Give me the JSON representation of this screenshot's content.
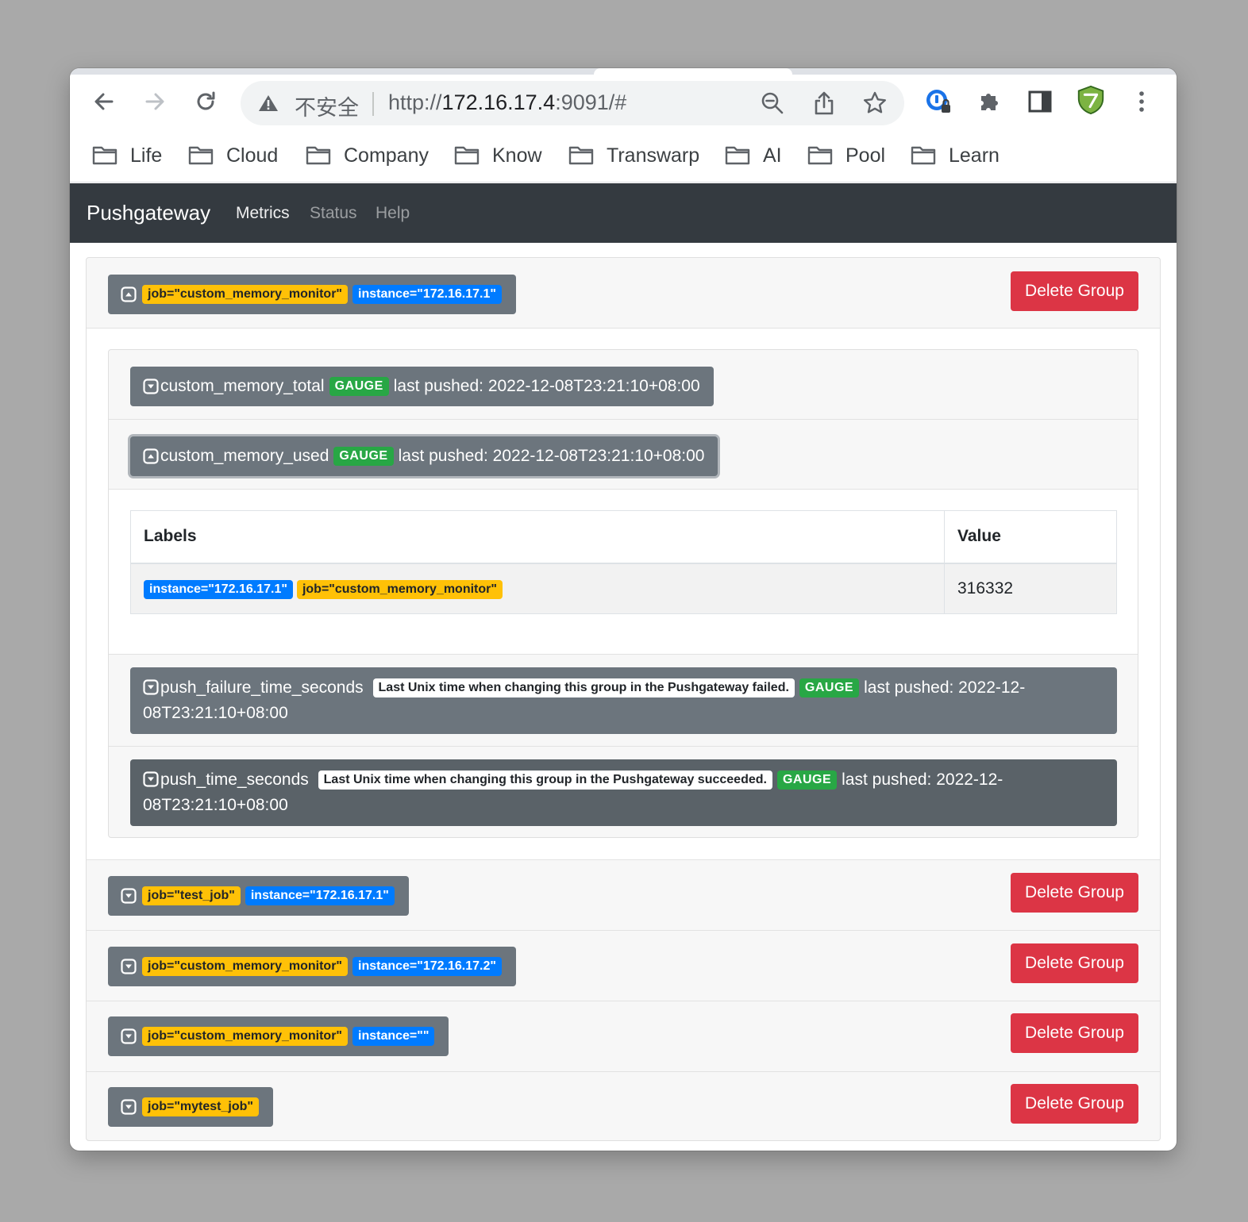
{
  "browser": {
    "security_label": "不安全",
    "url_scheme": "http://",
    "url_host": "172.16.17.4",
    "url_rest": ":9091/#",
    "bookmarks": [
      "Life",
      "Cloud",
      "Company",
      "Know",
      "Transwarp",
      "AI",
      "Pool",
      "Learn"
    ]
  },
  "navbar": {
    "brand": "Pushgateway",
    "links": [
      "Metrics",
      "Status",
      "Help"
    ],
    "active": "Metrics"
  },
  "groups": [
    {
      "labels": [
        {
          "text": "job=\"custom_memory_monitor\"",
          "kind": "job"
        },
        {
          "text": "instance=\"172.16.17.1\"",
          "kind": "instance"
        }
      ],
      "expanded": true,
      "delete_label": "Delete Group"
    },
    {
      "labels": [
        {
          "text": "job=\"test_job\"",
          "kind": "job"
        },
        {
          "text": "instance=\"172.16.17.1\"",
          "kind": "instance"
        }
      ],
      "expanded": false,
      "delete_label": "Delete Group"
    },
    {
      "labels": [
        {
          "text": "job=\"custom_memory_monitor\"",
          "kind": "job"
        },
        {
          "text": "instance=\"172.16.17.2\"",
          "kind": "instance"
        }
      ],
      "expanded": false,
      "delete_label": "Delete Group"
    },
    {
      "labels": [
        {
          "text": "job=\"custom_memory_monitor\"",
          "kind": "job"
        },
        {
          "text": "instance=\"\"",
          "kind": "instance"
        }
      ],
      "expanded": false,
      "delete_label": "Delete Group"
    },
    {
      "labels": [
        {
          "text": "job=\"mytest_job\"",
          "kind": "job"
        }
      ],
      "expanded": false,
      "delete_label": "Delete Group"
    }
  ],
  "metrics": [
    {
      "name": "custom_memory_total",
      "help": "",
      "type": "GAUGE",
      "last_pushed": "last pushed: 2022-12-08T23:21:10+08:00",
      "expanded": false
    },
    {
      "name": "custom_memory_used",
      "help": "",
      "type": "GAUGE",
      "last_pushed": "last pushed: 2022-12-08T23:21:10+08:00",
      "expanded": true
    },
    {
      "name": "push_failure_time_seconds",
      "help": "Last Unix time when changing this group in the Pushgateway failed.",
      "type": "GAUGE",
      "last_pushed": "last pushed: 2022-12-08T23:21:10+08:00",
      "expanded": false
    },
    {
      "name": "push_time_seconds",
      "help": "Last Unix time when changing this group in the Pushgateway succeeded.",
      "type": "GAUGE",
      "last_pushed": "last pushed: 2022-12-08T23:21:10+08:00",
      "expanded": false
    }
  ],
  "value_table": {
    "headers": [
      "Labels",
      "Value"
    ],
    "rows": [
      {
        "labels": [
          {
            "text": "instance=\"172.16.17.1\"",
            "kind": "instance"
          },
          {
            "text": "job=\"custom_memory_monitor\"",
            "kind": "job"
          }
        ],
        "value": "316332"
      }
    ]
  },
  "colors": {
    "navbar_bg": "#343a40",
    "job_badge": "#ffc107",
    "instance_badge": "#007bff",
    "gauge_badge": "#28a745",
    "delete_button": "#dc3545",
    "group_button": "#6c757d"
  }
}
